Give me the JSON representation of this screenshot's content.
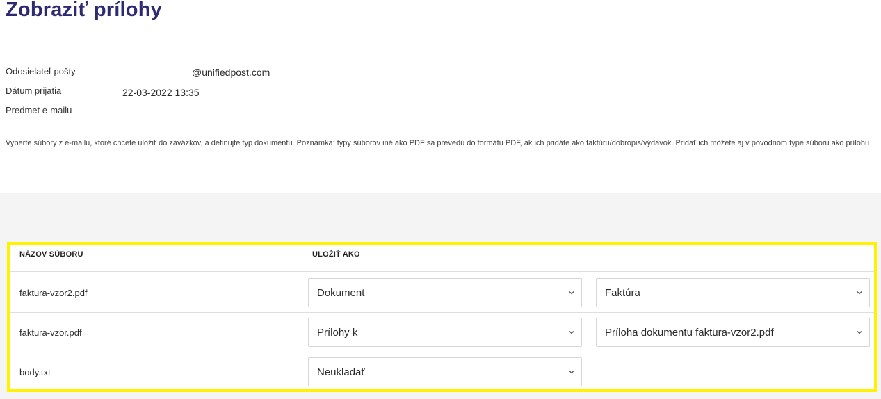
{
  "page": {
    "title": "Zobraziť prílohy"
  },
  "meta": {
    "sender_label": "Odosielateľ pošty",
    "sender_value": "@unifiedpost.com",
    "date_label": "Dátum prijatia",
    "date_value": "22-03-2022 13:35",
    "subject_label": "Predmet e-mailu",
    "subject_value": ""
  },
  "note": "Vyberte súbory z e-mailu, ktoré chcete uložiť do záväzkov, a definujte typ dokumentu. Poznámka: typy súborov iné ako PDF sa prevedú do formátu PDF, ak ich pridáte ako faktúru/dobropis/výdavok. Pridať ich môžete aj v pôvodnom type súboru ako prílohu",
  "table": {
    "col_filename": "NÁZOV SÚBORU",
    "col_save_as": "ULOŽIŤ AKO",
    "rows": [
      {
        "filename": "faktura-vzor2.pdf",
        "save_as": "Dokument",
        "detail": "Faktúra"
      },
      {
        "filename": "faktura-vzor.pdf",
        "save_as": "Prílohy k",
        "detail": "Príloha dokumentu faktura-vzor2.pdf"
      },
      {
        "filename": "body.txt",
        "save_as": "Neukladať",
        "detail": ""
      }
    ]
  },
  "icons": {
    "dropdown": "chevron-down-icon"
  },
  "colors": {
    "title": "#2e2a72",
    "highlight": "#fff200",
    "band": "#f4f4f4"
  }
}
